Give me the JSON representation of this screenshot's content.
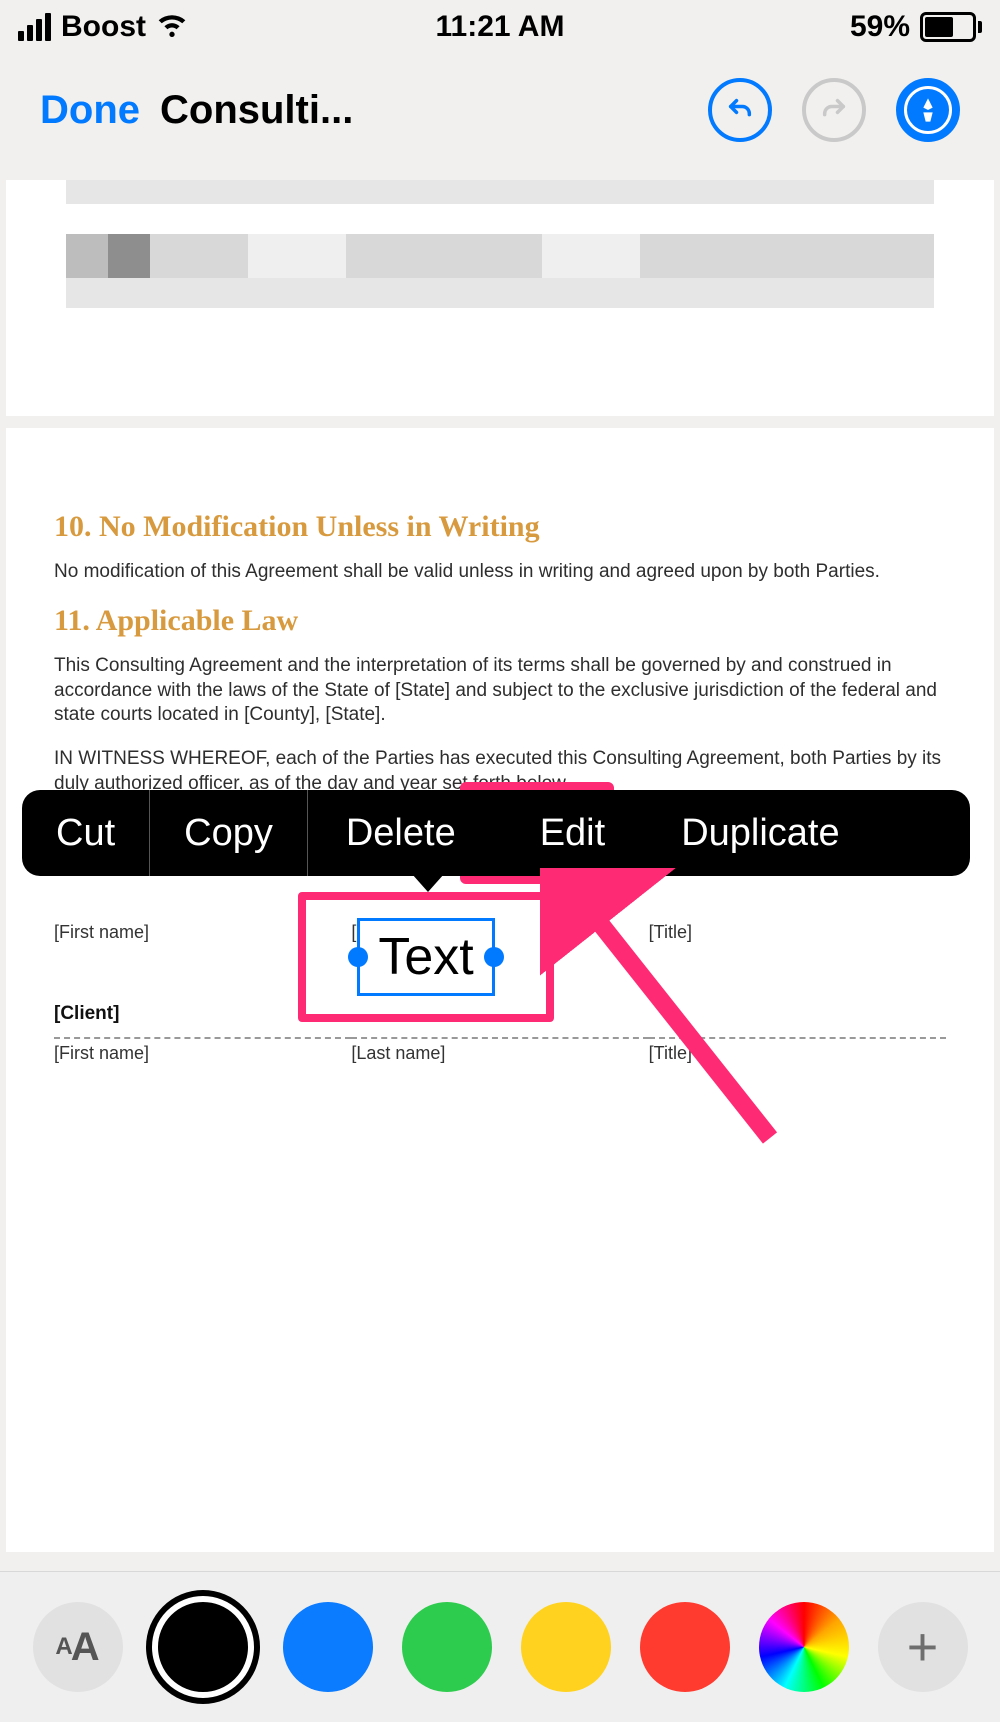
{
  "status": {
    "carrier": "Boost",
    "time": "11:21 AM",
    "battery_pct": "59%"
  },
  "nav": {
    "done": "Done",
    "title": "Consulti..."
  },
  "doc": {
    "h10": "10. No Modification Unless in Writing",
    "p10": "No modification of this Agreement shall be valid unless in writing and agreed upon by both Parties.",
    "h11": "11. Applicable Law",
    "p11": "This Consulting Agreement and the interpretation of its terms shall be governed by and construed in accordance with the laws of the State of [State] and subject to the exclusive jurisdiction of the federal and state courts located in [County], [State].",
    "witness": "IN WITNESS WHEREOF, each of the Parties has executed this Consulting Agreement, both Parties by its duly authorized officer, as of the day and year set forth below.",
    "client_label": "[Client]",
    "cols": {
      "first": "[First name]",
      "last": "[Last name]",
      "title": "[Title]"
    }
  },
  "ctx": {
    "cut": "Cut",
    "copy": "Copy",
    "delete": "Delete",
    "edit": "Edit",
    "duplicate": "Duplicate"
  },
  "textbox": {
    "value": "Text"
  },
  "palette": {
    "text_small": "A",
    "text_large": "A",
    "plus": "+"
  }
}
